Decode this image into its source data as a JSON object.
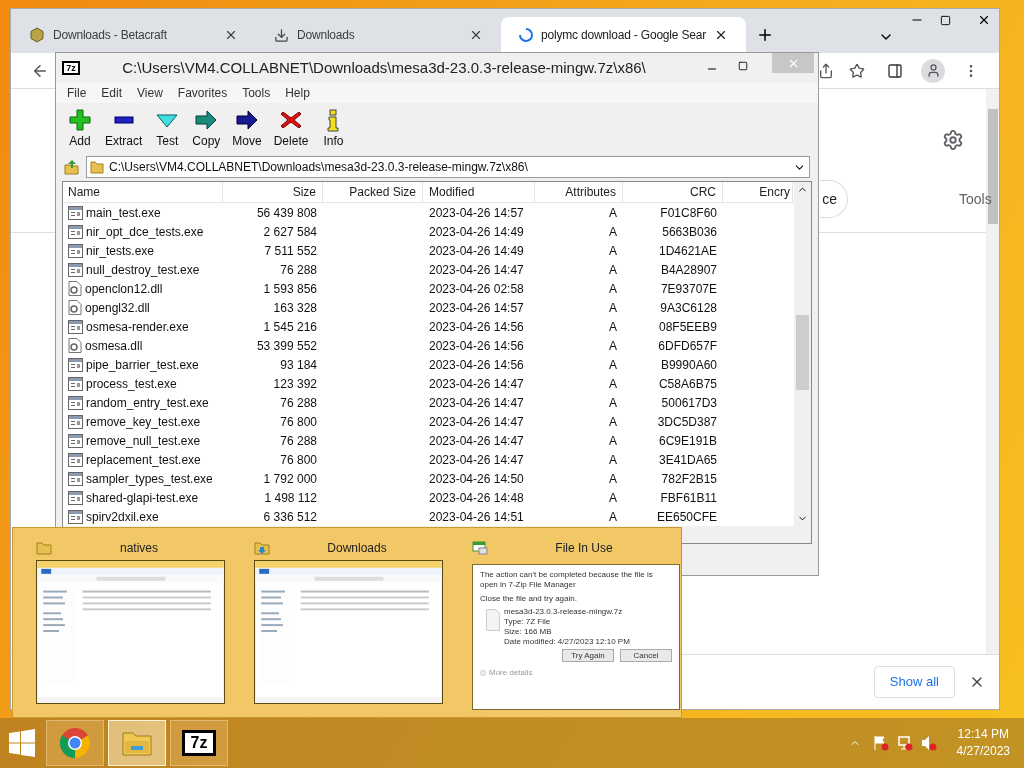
{
  "browser": {
    "tabs": [
      {
        "title": "Downloads - Betacraft",
        "selected": false
      },
      {
        "title": "Downloads",
        "selected": false
      },
      {
        "title": "polymc download - Google Sear",
        "selected": true
      }
    ],
    "page_fragments": [
      "ce",
      "Tools"
    ],
    "download_bar": {
      "button": "Show all"
    }
  },
  "sevenzip": {
    "logo": "7z",
    "title": "C:\\Users\\VM4.COLLABNET\\Downloads\\mesa3d-23.0.3-release-mingw.7z\\x86\\",
    "menu": [
      "File",
      "Edit",
      "View",
      "Favorites",
      "Tools",
      "Help"
    ],
    "toolbar": [
      {
        "label": "Add",
        "kind": "add"
      },
      {
        "label": "Extract",
        "kind": "extract"
      },
      {
        "label": "Test",
        "kind": "test"
      },
      {
        "label": "Copy",
        "kind": "copy"
      },
      {
        "label": "Move",
        "kind": "move"
      },
      {
        "label": "Delete",
        "kind": "delete"
      },
      {
        "label": "Info",
        "kind": "info"
      }
    ],
    "address": "C:\\Users\\VM4.COLLABNET\\Downloads\\mesa3d-23.0.3-release-mingw.7z\\x86\\",
    "columns": [
      "Name",
      "Size",
      "Packed Size",
      "Modified",
      "Attributes",
      "CRC",
      "Encry"
    ],
    "rows": [
      {
        "name": "main_test.exe",
        "kind": "exe",
        "size": "56 439 808",
        "modified": "2023-04-26 14:57",
        "attributes": "A",
        "crc": "F01C8F60"
      },
      {
        "name": "nir_opt_dce_tests.exe",
        "kind": "exe",
        "size": "2 627 584",
        "modified": "2023-04-26 14:49",
        "attributes": "A",
        "crc": "5663B036"
      },
      {
        "name": "nir_tests.exe",
        "kind": "exe",
        "size": "7 511 552",
        "modified": "2023-04-26 14:49",
        "attributes": "A",
        "crc": "1D4621AE"
      },
      {
        "name": "null_destroy_test.exe",
        "kind": "exe",
        "size": "76 288",
        "modified": "2023-04-26 14:47",
        "attributes": "A",
        "crc": "B4A28907"
      },
      {
        "name": "openclon12.dll",
        "kind": "dll",
        "size": "1 593 856",
        "modified": "2023-04-26 02:58",
        "attributes": "A",
        "crc": "7E93707E"
      },
      {
        "name": "opengl32.dll",
        "kind": "dll",
        "size": "163 328",
        "modified": "2023-04-26 14:57",
        "attributes": "A",
        "crc": "9A3C6128"
      },
      {
        "name": "osmesa-render.exe",
        "kind": "exe",
        "size": "1 545 216",
        "modified": "2023-04-26 14:56",
        "attributes": "A",
        "crc": "08F5EEB9"
      },
      {
        "name": "osmesa.dll",
        "kind": "dll",
        "size": "53 399 552",
        "modified": "2023-04-26 14:56",
        "attributes": "A",
        "crc": "6DFD657F"
      },
      {
        "name": "pipe_barrier_test.exe",
        "kind": "exe",
        "size": "93 184",
        "modified": "2023-04-26 14:56",
        "attributes": "A",
        "crc": "B9990A60"
      },
      {
        "name": "process_test.exe",
        "kind": "exe",
        "size": "123 392",
        "modified": "2023-04-26 14:47",
        "attributes": "A",
        "crc": "C58A6B75"
      },
      {
        "name": "random_entry_test.exe",
        "kind": "exe",
        "size": "76 288",
        "modified": "2023-04-26 14:47",
        "attributes": "A",
        "crc": "500617D3"
      },
      {
        "name": "remove_key_test.exe",
        "kind": "exe",
        "size": "76 800",
        "modified": "2023-04-26 14:47",
        "attributes": "A",
        "crc": "3DC5D387"
      },
      {
        "name": "remove_null_test.exe",
        "kind": "exe",
        "size": "76 288",
        "modified": "2023-04-26 14:47",
        "attributes": "A",
        "crc": "6C9E191B"
      },
      {
        "name": "replacement_test.exe",
        "kind": "exe",
        "size": "76 800",
        "modified": "2023-04-26 14:47",
        "attributes": "A",
        "crc": "3E41DA65"
      },
      {
        "name": "sampler_types_test.exe",
        "kind": "exe",
        "size": "1 792 000",
        "modified": "2023-04-26 14:50",
        "attributes": "A",
        "crc": "782F2B15"
      },
      {
        "name": "shared-glapi-test.exe",
        "kind": "exe",
        "size": "1 498 112",
        "modified": "2023-04-26 14:48",
        "attributes": "A",
        "crc": "FBF61B11"
      },
      {
        "name": "spirv2dxil.exe",
        "kind": "exe",
        "size": "6 336 512",
        "modified": "2023-04-26 14:51",
        "attributes": "A",
        "crc": "EE650CFE"
      }
    ]
  },
  "thumbnails": [
    {
      "title": "natives",
      "kind": "explorer"
    },
    {
      "title": "Downloads",
      "kind": "explorer"
    },
    {
      "title": "File In Use",
      "kind": "dialog",
      "message": "The action can't be completed because the file is open in 7-Zip File Manager",
      "hint": "Close the file and try again.",
      "details": [
        "mesa3d-23.0.3-release-mingw.7z",
        "Type: 7Z File",
        "Size: 166 MB",
        "Date modified: 4/27/2023 12:10 PM"
      ],
      "buttons": [
        "Try Again",
        "Cancel"
      ],
      "more": "More details"
    }
  ],
  "taskbar": {
    "apps": [
      {
        "kind": "chrome",
        "highlighted": false
      },
      {
        "kind": "explorer",
        "highlighted": true
      },
      {
        "kind": "sevenzip",
        "logo": "7z",
        "highlighted": false
      }
    ],
    "time": "12:14 PM",
    "date": "4/27/2023"
  }
}
